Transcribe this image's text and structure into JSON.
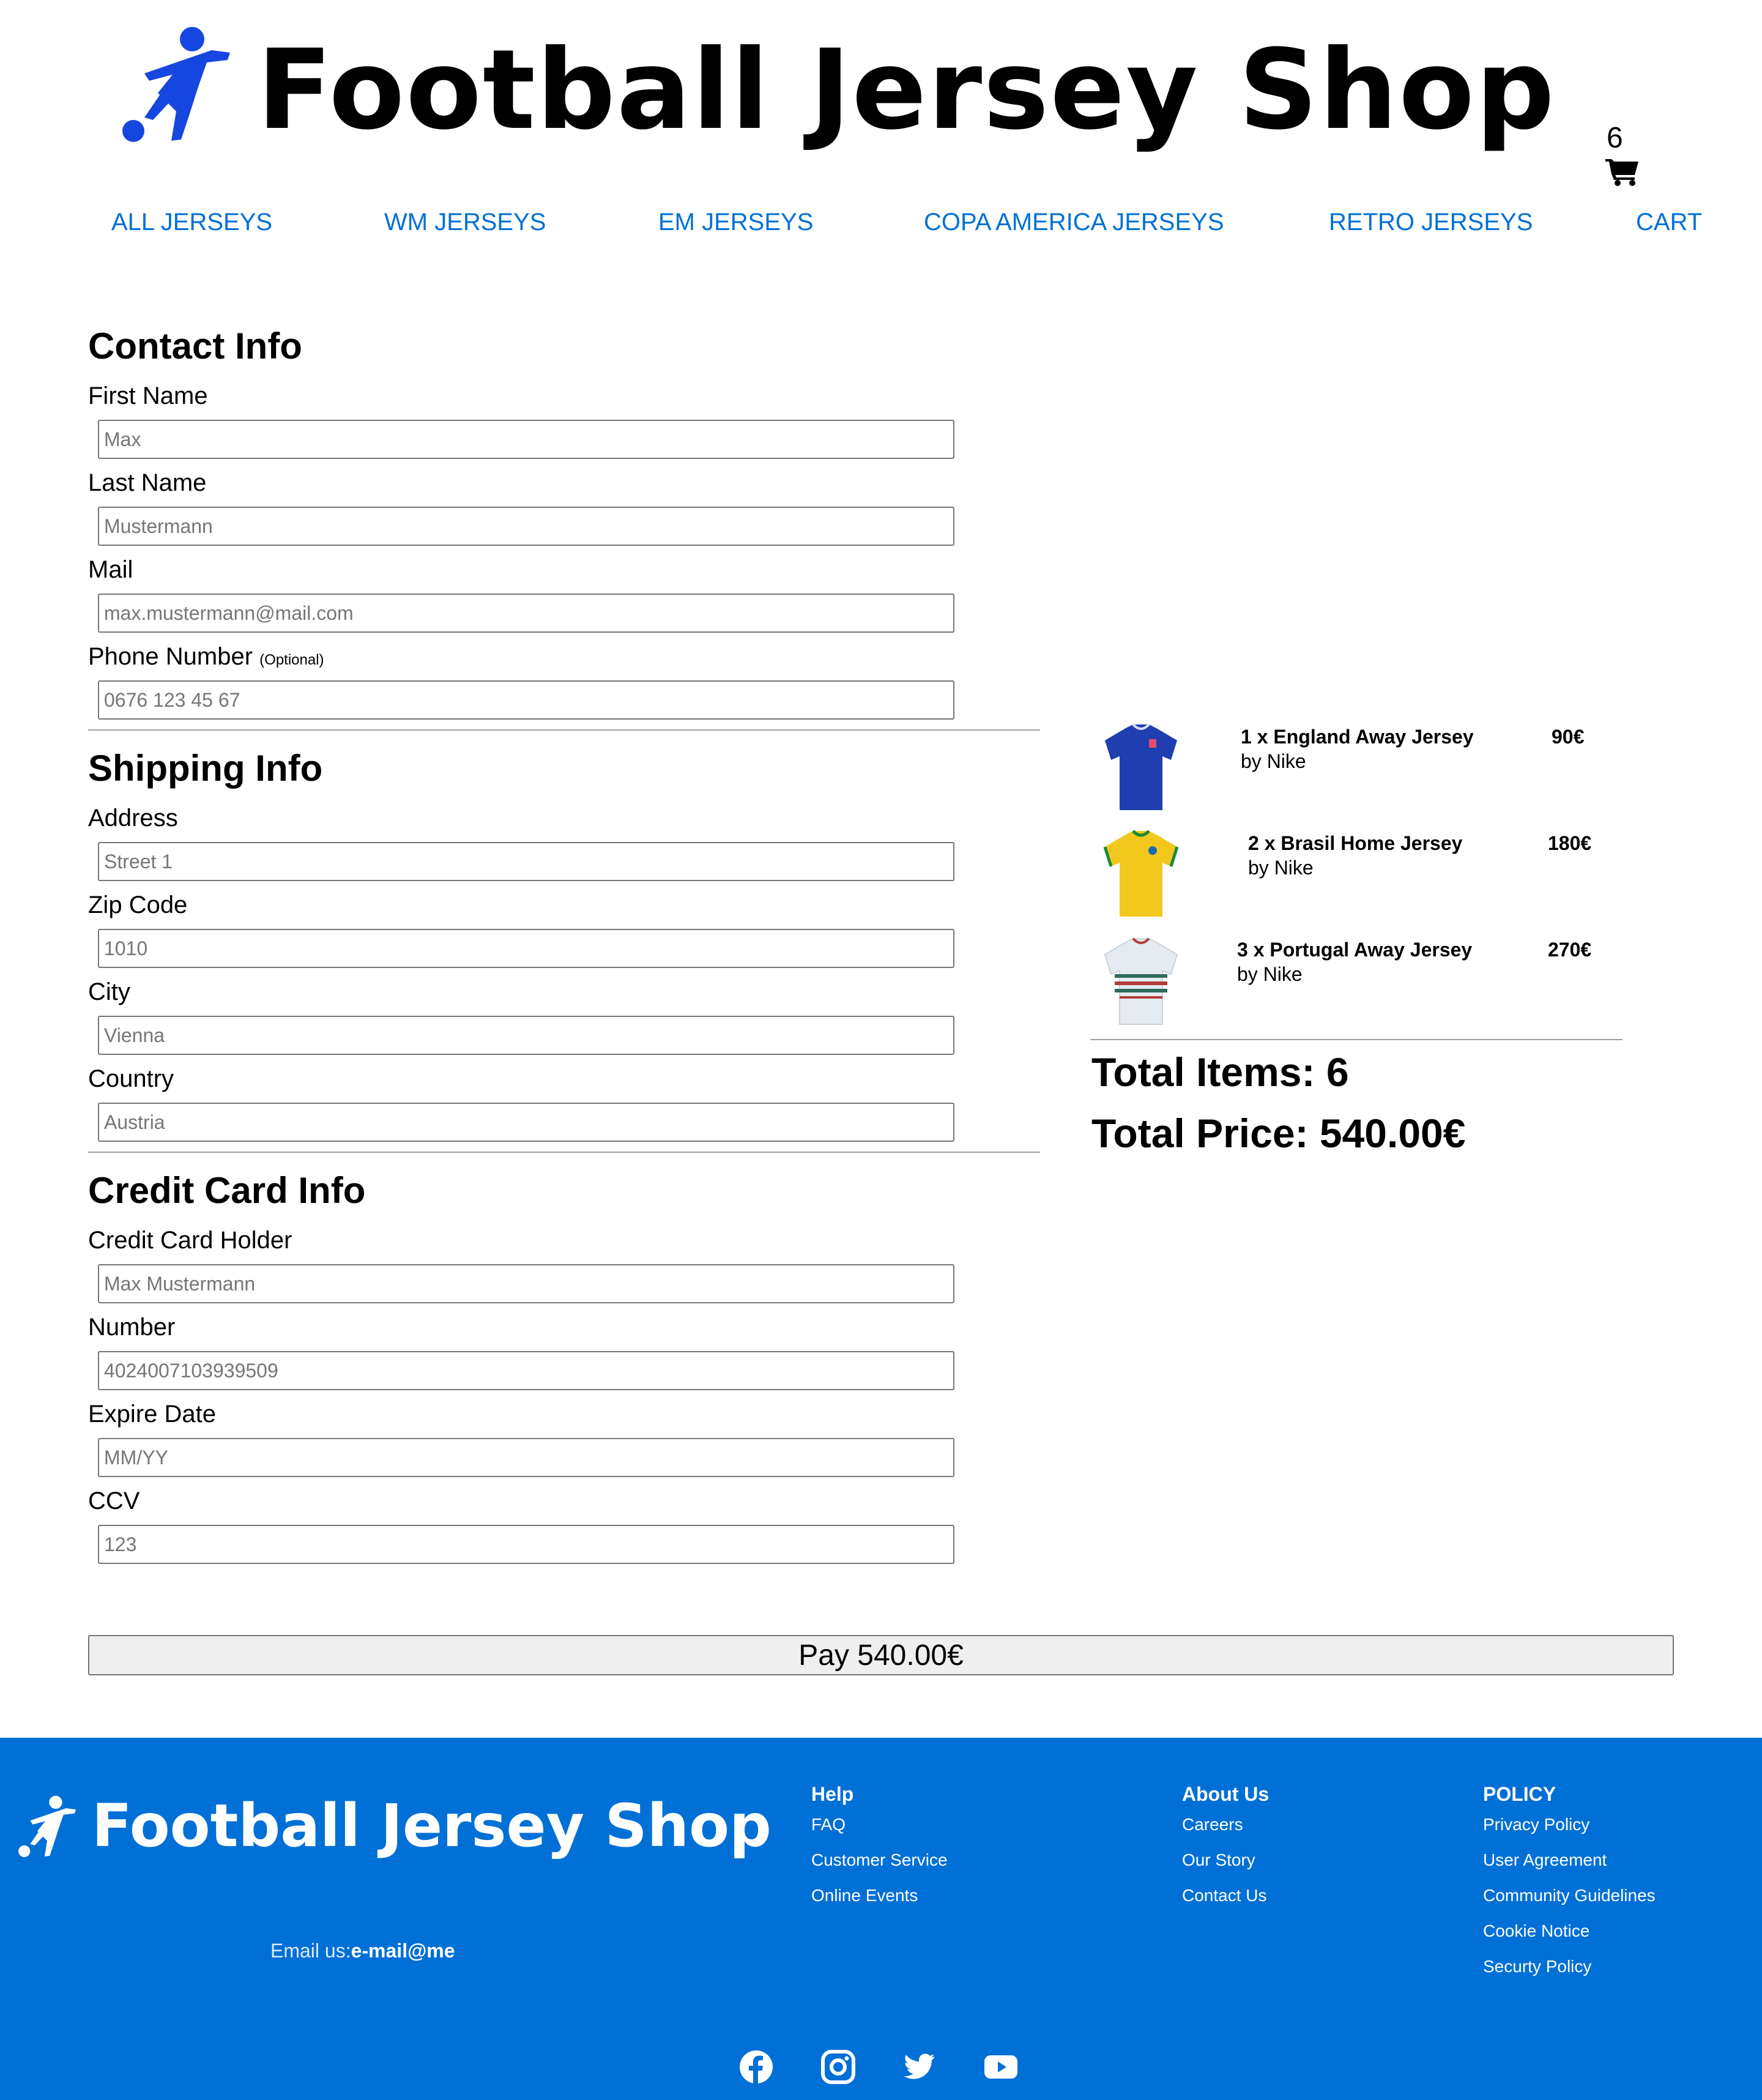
{
  "header": {
    "title": "Football Jersey Shop",
    "cart_count": "6",
    "nav": [
      "ALL JERSEYS",
      "WM JERSEYS",
      "EM JERSEYS",
      "COPA AMERICA JERSEYS",
      "RETRO JERSEYS",
      "CART"
    ]
  },
  "contact": {
    "heading": "Contact Info",
    "first_name_label": "First Name",
    "first_name_placeholder": "Max",
    "last_name_label": "Last Name",
    "last_name_placeholder": "Mustermann",
    "mail_label": "Mail",
    "mail_placeholder": "max.mustermann@mail.com",
    "phone_label": "Phone Number",
    "phone_optional": "(Optional)",
    "phone_placeholder": "0676 123 45 67"
  },
  "shipping": {
    "heading": "Shipping Info",
    "address_label": "Address",
    "address_placeholder": "Street 1",
    "zip_label": "Zip Code",
    "zip_placeholder": "1010",
    "city_label": "City",
    "city_placeholder": "Vienna",
    "country_label": "Country",
    "country_placeholder": "Austria"
  },
  "card": {
    "heading": "Credit Card Info",
    "holder_label": "Credit Card Holder",
    "holder_placeholder": "Max Mustermann",
    "number_label": "Number",
    "number_placeholder": "4024007103939509",
    "expire_label": "Expire Date",
    "expire_placeholder": "MM/YY",
    "ccv_label": "CCV",
    "ccv_placeholder": "123"
  },
  "order": {
    "items": [
      {
        "title": "1 x England Away Jersey",
        "brand": "by Nike",
        "price": "90€"
      },
      {
        "title": "2 x Brasil Home Jersey",
        "brand": "by Nike",
        "price": "180€"
      },
      {
        "title": "3 x Portugal Away Jersey",
        "brand": "by Nike",
        "price": "270€"
      }
    ],
    "total_items": "Total Items: 6",
    "total_price": "Total Price: 540.00€"
  },
  "pay_button": "Pay 540.00€",
  "footer": {
    "title": "Football Jersey Shop",
    "email_label": "Email us:",
    "email_value": "e-mail@me",
    "help": {
      "heading": "Help",
      "links": [
        "FAQ",
        "Customer Service",
        "Online Events"
      ]
    },
    "about": {
      "heading": "About Us",
      "links": [
        "Careers",
        "Our Story",
        "Contact Us"
      ]
    },
    "policy": {
      "heading": "POLICY",
      "links": [
        "Privacy Policy",
        "User Agreement",
        "Community Guidelines",
        "Cookie Notice",
        "Securty Policy"
      ]
    },
    "social": [
      "facebook-icon",
      "instagram-icon",
      "twitter-icon",
      "youtube-icon"
    ]
  },
  "colors": {
    "accent": "#0070d6",
    "logo_blue": "#1646e0"
  }
}
